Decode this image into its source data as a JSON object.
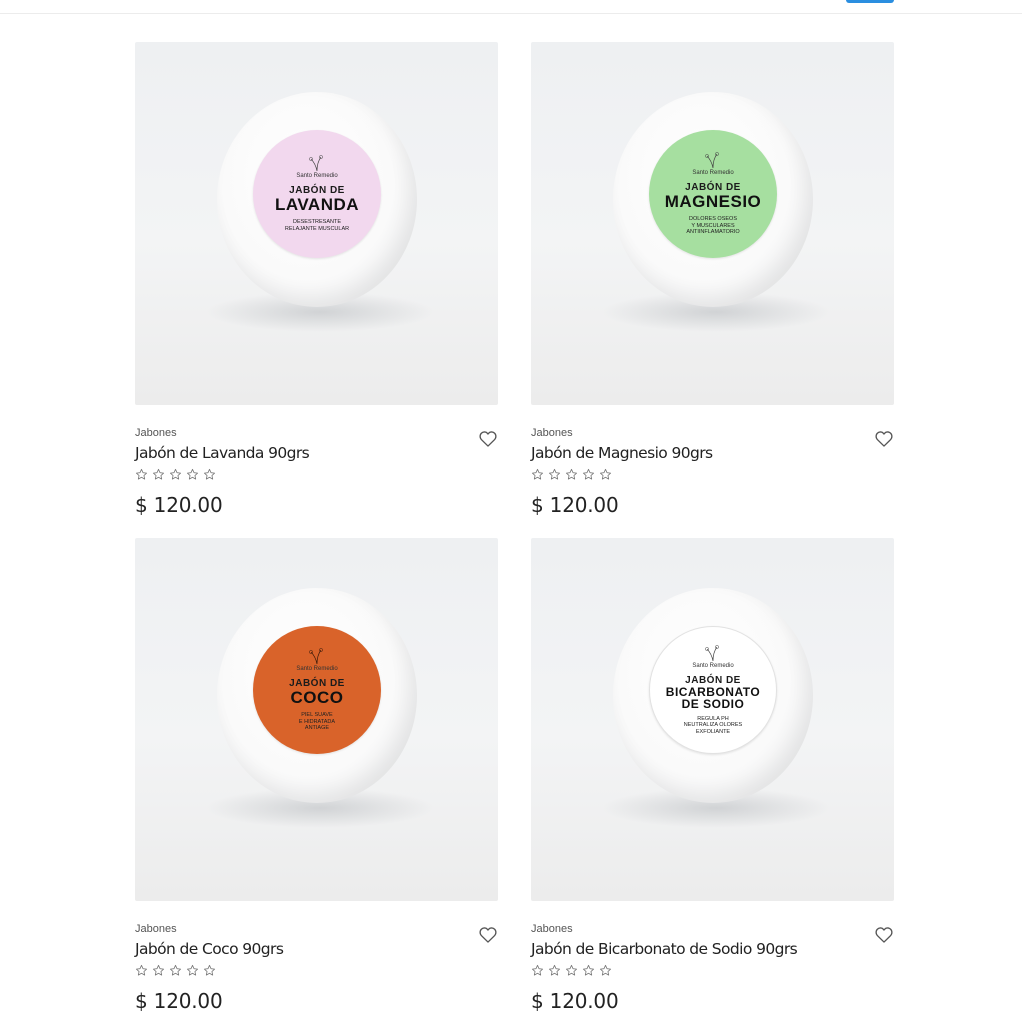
{
  "products": [
    {
      "category": "Jabones",
      "title": "Jabón de Lavanda 90grs",
      "price": "$ 120.00",
      "rating": 0,
      "label": {
        "brand": "Santo Remedio",
        "pre": "JABÓN DE",
        "main": "LAVANDA",
        "sub": "DESESTRESANTE\nRELAJANTE MUSCULAR",
        "color": "#f2d8ee"
      }
    },
    {
      "category": "Jabones",
      "title": "Jabón de Magnesio 90grs",
      "price": "$ 120.00",
      "rating": 0,
      "label": {
        "brand": "Santo Remedio",
        "pre": "JABÓN DE",
        "main": "MAGNESIO",
        "sub": "DOLORES OSEOS\nY MUSCULARES\nANTIINFLAMATORIO",
        "color": "#a6dfa0"
      }
    },
    {
      "category": "Jabones",
      "title": "Jabón de Coco 90grs",
      "price": "$ 120.00",
      "rating": 0,
      "label": {
        "brand": "Santo Remedio",
        "pre": "JABÓN DE",
        "main": "COCO",
        "sub": "PIEL SUAVE\nE HIDRATADA\nANTIAGE",
        "color": "#d9632a"
      }
    },
    {
      "category": "Jabones",
      "title": "Jabón de Bicarbonato de Sodio 90grs",
      "price": "$ 120.00",
      "rating": 0,
      "label": {
        "brand": "Santo Remedio",
        "pre": "JABÓN DE",
        "main": "BICARBONATO\nDE SODIO",
        "sub": "REGULA PH\nNEUTRALIZA OLORES\nEXFOLIANTE",
        "color": "#ffffff"
      }
    }
  ],
  "colors": {
    "accent": "#2a8ee0",
    "text": "#222222",
    "star_outline": "#777777"
  },
  "icons": {
    "wishlist": "heart-outline-icon",
    "rating": "star-outline-icon"
  }
}
